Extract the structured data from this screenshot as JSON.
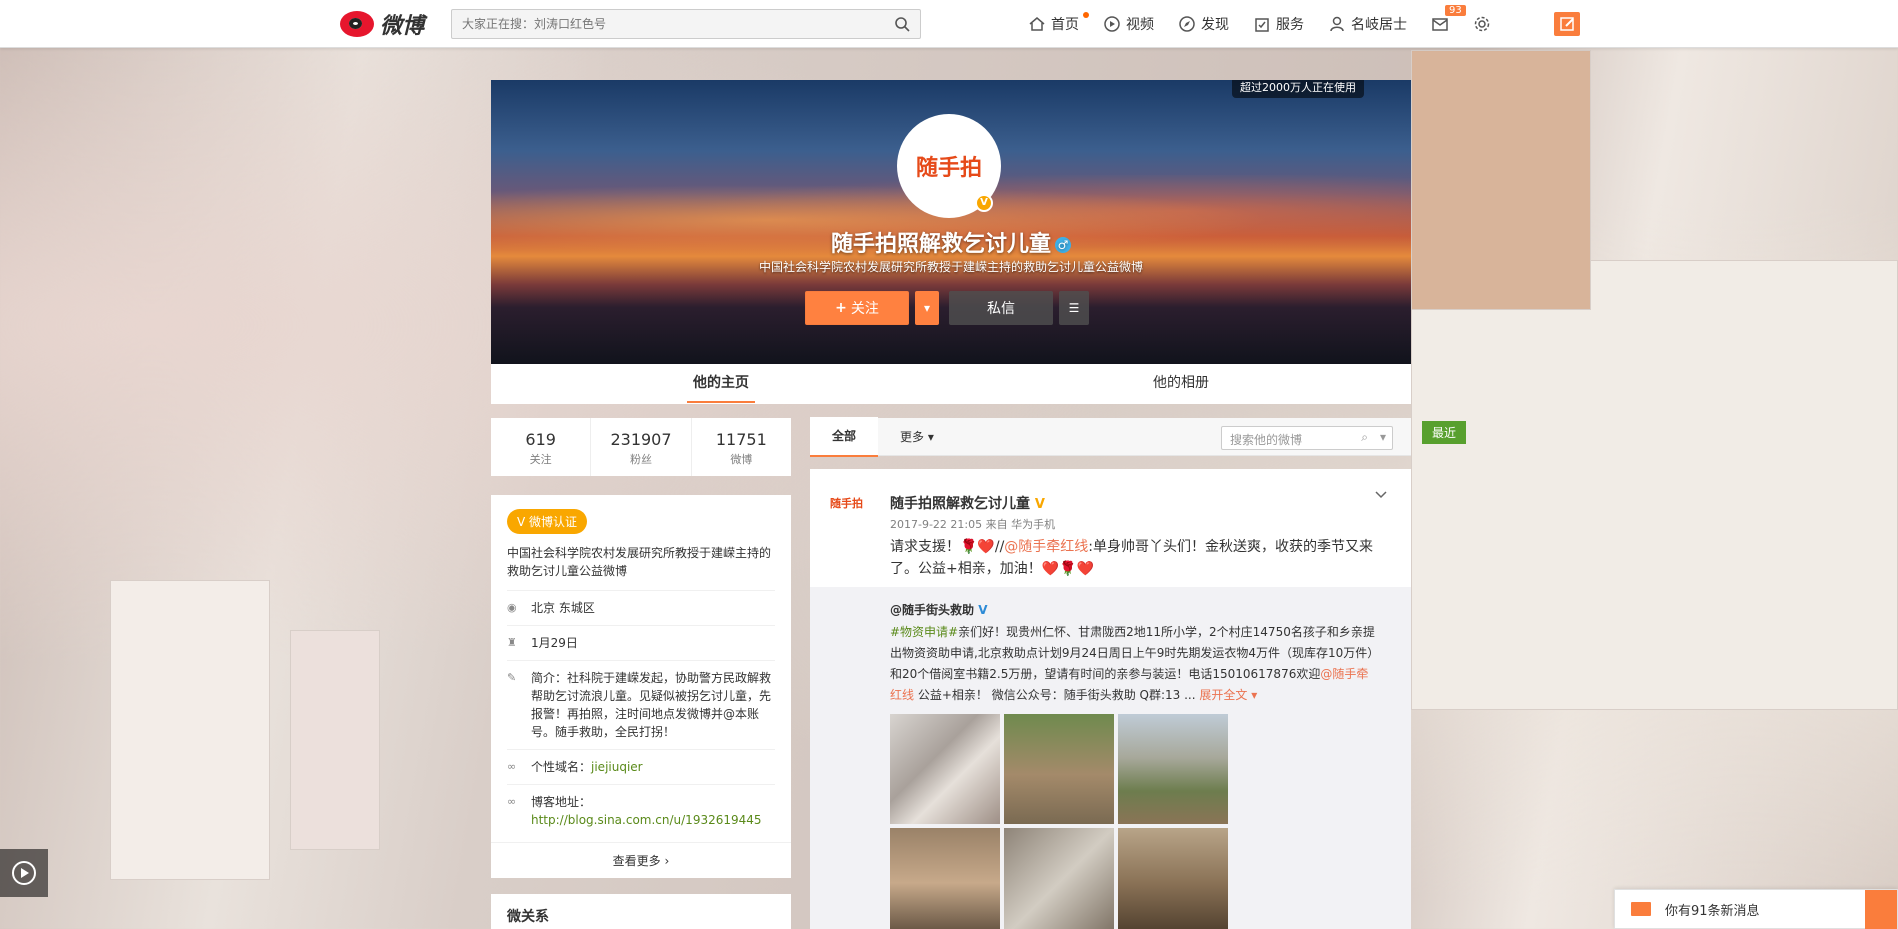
{
  "topbar": {
    "logo_text": "微博",
    "search_placeholder": "大家正在搜：刘涛口红色号",
    "nav": [
      {
        "label": "首页",
        "icon": "home-icon"
      },
      {
        "label": "视频",
        "icon": "video-icon"
      },
      {
        "label": "发现",
        "icon": "discover-icon"
      },
      {
        "label": "服务",
        "icon": "service-icon"
      },
      {
        "label": "名岐居士",
        "icon": "user-icon"
      }
    ],
    "message_count": "93"
  },
  "cover": {
    "usage_text": "超过2000万人正在使用",
    "avatar_text": "随手拍",
    "profile_name": "随手拍照解救乞讨儿童",
    "profile_desc": "中国社会科学院农村发展研究所教授于建嵘主持的救助乞讨儿童公益微博",
    "follow_label": "关注",
    "message_label": "私信"
  },
  "tabs": [
    "他的主页",
    "他的相册"
  ],
  "stats": [
    {
      "value": "619",
      "label": "关注"
    },
    {
      "value": "231907",
      "label": "粉丝"
    },
    {
      "value": "11751",
      "label": "微博"
    }
  ],
  "info": {
    "verify_label": "微博认证",
    "verify_desc": "中国社会科学院农村发展研究所教授于建嵘主持的救助乞讨儿童公益微博",
    "location": "北京 东城区",
    "birthday": "1月29日",
    "intro": "简介：社科院于建嵘发起，协助警方民政解救帮助乞讨流浪儿童。见疑似被拐乞讨儿童，先报警！再拍照，注时间地点发微博并@本账号。随手救助，全民打拐！",
    "domain_label": "个性域名：",
    "domain_value": "jiejiuqier",
    "blog_label": "博客地址：",
    "blog_value": "http://blog.sina.com.cn/u/1932619445",
    "more_label": "查看更多",
    "relations_title": "微关系"
  },
  "feed": {
    "tab_all": "全部",
    "tab_more": "更多",
    "search_placeholder": "搜索他的微博",
    "recent_label": "最近"
  },
  "post": {
    "avatar_text": "随手拍",
    "author": "随手拍照解救乞讨儿童",
    "meta": "2017-9-22 21:05 来自 华为手机",
    "text_a": "请求支援！🌹❤️//",
    "text_at": "@随手牵红线",
    "text_b": ":单身帅哥丫头们！金秋送爽，收获的季节又来了。公益+相亲，加油！❤️🌹❤️",
    "repost_author": "@随手街头救助",
    "repost_tag": "#物资申请#",
    "repost_text_a": "亲们好！现贵州仁怀、甘肃陇西2地11所小学，2个村庄14750名孩子和乡亲提出物资资助申请,北京救助点计划9月24日周日上午9时先期发运衣物4万件（现库存10万件）和20个借阅室书籍2.5万册，望请有时间的亲参与装运！电话15010617876欢迎",
    "repost_at": "@随手牵红线",
    "repost_text_b": " 公益+相亲！ 微信公众号：随手街头救助 Q群:13 ...",
    "expand_label": "展开全文"
  },
  "notice_text": "你有91条新消息",
  "colors": {
    "accent": "#fa7d3c",
    "verified": "#f9a700",
    "link_green": "#5a8a1a"
  }
}
